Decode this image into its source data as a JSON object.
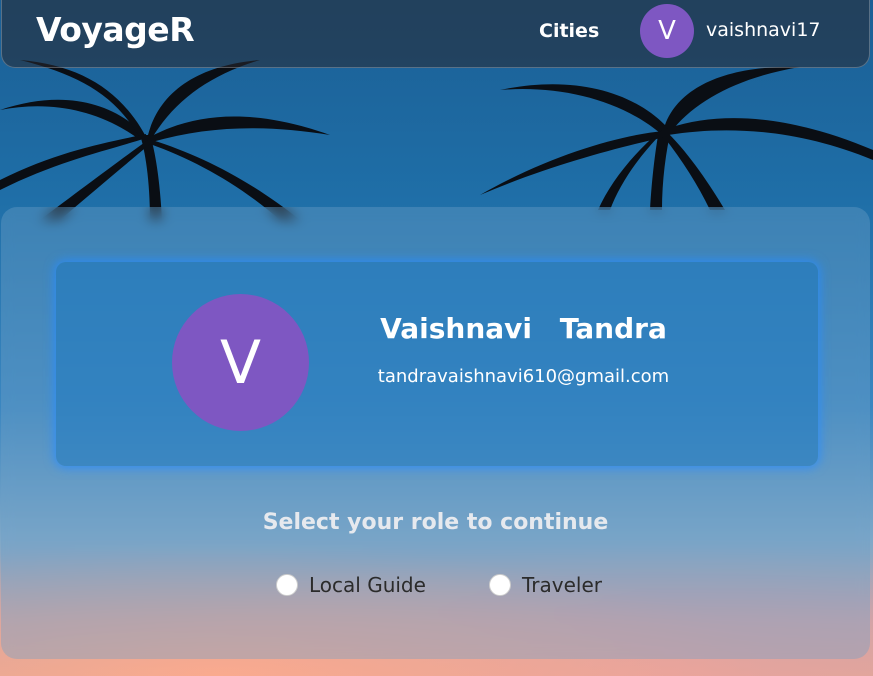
{
  "navbar": {
    "brand": "VoyageR",
    "cities_link": "Cities",
    "avatar_initial": "V",
    "username": "vaishnavi17"
  },
  "profile": {
    "avatar_initial": "V",
    "name": "Vaishnavi Tandra",
    "email": "tandravaishnavi610@gmail.com"
  },
  "role_selection": {
    "title": "Select your role to continue",
    "options": [
      {
        "label": "Local Guide",
        "selected": false
      },
      {
        "label": "Traveler",
        "selected": false
      }
    ]
  },
  "colors": {
    "avatar": "#7e57c2",
    "accent_glow": "#288cff"
  }
}
